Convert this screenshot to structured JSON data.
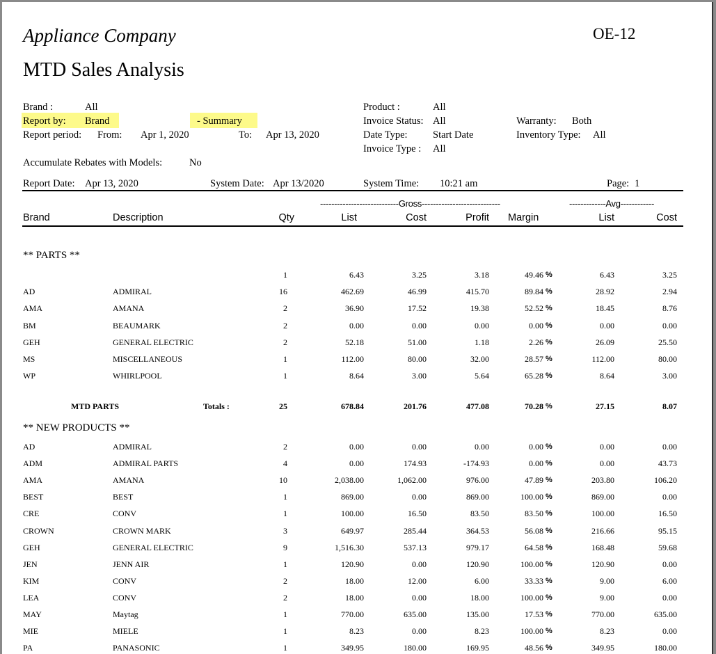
{
  "header": {
    "company": "Appliance Company",
    "report_id": "OE-12",
    "title": "MTD Sales Analysis"
  },
  "params": {
    "brand_label": "Brand :",
    "brand_value": "All",
    "report_by_label": "Report by:",
    "report_by_value": "Brand",
    "summary": "- Summary",
    "period_label": "Report period:",
    "from_label": "From:",
    "from_value": "Apr 1, 2020",
    "to_label": "To:",
    "to_value": "Apr 13, 2020",
    "product_label": "Product :",
    "product_value": "All",
    "invoice_status_label": "Invoice Status:",
    "invoice_status_value": "All",
    "date_type_label": "Date Type:",
    "date_type_value": "Start Date",
    "invoice_type_label": "Invoice Type :",
    "invoice_type_value": "All",
    "warranty_label": "Warranty:",
    "warranty_value": "Both",
    "inventory_type_label": "Inventory Type:",
    "inventory_type_value": "All",
    "accum_label": "Accumulate Rebates with Models:",
    "accum_value": "No",
    "report_date_label": "Report Date:",
    "report_date_value": "Apr 13, 2020",
    "system_date_label": "System Date:",
    "system_date_value": "Apr 13/2020",
    "system_time_label": "System Time:",
    "system_time_value": "10:21 am",
    "page_label": "Page:",
    "page_value": "1"
  },
  "columns": {
    "gross_group": "----------------------------Gross----------------------------",
    "avg_group": "-------------Avg------------",
    "brand": "Brand",
    "description": "Description",
    "qty": "Qty",
    "list": "List",
    "cost": "Cost",
    "profit": "Profit",
    "margin": "Margin",
    "avg_list": "List",
    "avg_cost": "Cost"
  },
  "sections": [
    {
      "title": "** PARTS **",
      "rows": [
        {
          "brand": "",
          "desc": "",
          "qty": "1",
          "list": "6.43",
          "cost": "3.25",
          "profit": "3.18",
          "margin": "49.46",
          "avg_list": "6.43",
          "avg_cost": "3.25"
        },
        {
          "brand": "AD",
          "desc": "ADMIRAL",
          "qty": "16",
          "list": "462.69",
          "cost": "46.99",
          "profit": "415.70",
          "margin": "89.84",
          "avg_list": "28.92",
          "avg_cost": "2.94"
        },
        {
          "brand": "AMA",
          "desc": "AMANA",
          "qty": "2",
          "list": "36.90",
          "cost": "17.52",
          "profit": "19.38",
          "margin": "52.52",
          "avg_list": "18.45",
          "avg_cost": "8.76"
        },
        {
          "brand": "BM",
          "desc": "BEAUMARK",
          "qty": "2",
          "list": "0.00",
          "cost": "0.00",
          "profit": "0.00",
          "margin": "0.00",
          "avg_list": "0.00",
          "avg_cost": "0.00"
        },
        {
          "brand": "GEH",
          "desc": "GENERAL ELECTRIC",
          "qty": "2",
          "list": "52.18",
          "cost": "51.00",
          "profit": "1.18",
          "margin": "2.26",
          "avg_list": "26.09",
          "avg_cost": "25.50"
        },
        {
          "brand": "MS",
          "desc": "MISCELLANEOUS",
          "qty": "1",
          "list": "112.00",
          "cost": "80.00",
          "profit": "32.00",
          "margin": "28.57",
          "avg_list": "112.00",
          "avg_cost": "80.00"
        },
        {
          "brand": "WP",
          "desc": "WHIRLPOOL",
          "qty": "1",
          "list": "8.64",
          "cost": "3.00",
          "profit": "5.64",
          "margin": "65.28",
          "avg_list": "8.64",
          "avg_cost": "3.00"
        }
      ],
      "total": {
        "label": "MTD  PARTS",
        "totals_label": "Totals :",
        "qty": "25",
        "list": "678.84",
        "cost": "201.76",
        "profit": "477.08",
        "margin": "70.28",
        "avg_list": "27.15",
        "avg_cost": "8.07"
      }
    },
    {
      "title": "** NEW PRODUCTS **",
      "rows": [
        {
          "brand": "AD",
          "desc": "ADMIRAL",
          "qty": "2",
          "list": "0.00",
          "cost": "0.00",
          "profit": "0.00",
          "margin": "0.00",
          "avg_list": "0.00",
          "avg_cost": "0.00"
        },
        {
          "brand": "ADM",
          "desc": "ADMIRAL PARTS",
          "qty": "4",
          "list": "0.00",
          "cost": "174.93",
          "profit": "-174.93",
          "margin": "0.00",
          "avg_list": "0.00",
          "avg_cost": "43.73"
        },
        {
          "brand": "AMA",
          "desc": "AMANA",
          "qty": "10",
          "list": "2,038.00",
          "cost": "1,062.00",
          "profit": "976.00",
          "margin": "47.89",
          "avg_list": "203.80",
          "avg_cost": "106.20"
        },
        {
          "brand": "BEST",
          "desc": "BEST",
          "qty": "1",
          "list": "869.00",
          "cost": "0.00",
          "profit": "869.00",
          "margin": "100.00",
          "avg_list": "869.00",
          "avg_cost": "0.00"
        },
        {
          "brand": "CRE",
          "desc": "CONV",
          "qty": "1",
          "list": "100.00",
          "cost": "16.50",
          "profit": "83.50",
          "margin": "83.50",
          "avg_list": "100.00",
          "avg_cost": "16.50"
        },
        {
          "brand": "CROWN",
          "desc": "CROWN MARK",
          "qty": "3",
          "list": "649.97",
          "cost": "285.44",
          "profit": "364.53",
          "margin": "56.08",
          "avg_list": "216.66",
          "avg_cost": "95.15"
        },
        {
          "brand": "GEH",
          "desc": "GENERAL ELECTRIC",
          "qty": "9",
          "list": "1,516.30",
          "cost": "537.13",
          "profit": "979.17",
          "margin": "64.58",
          "avg_list": "168.48",
          "avg_cost": "59.68"
        },
        {
          "brand": "JEN",
          "desc": "JENN AIR",
          "qty": "1",
          "list": "120.90",
          "cost": "0.00",
          "profit": "120.90",
          "margin": "100.00",
          "avg_list": "120.90",
          "avg_cost": "0.00"
        },
        {
          "brand": "KIM",
          "desc": "CONV",
          "qty": "2",
          "list": "18.00",
          "cost": "12.00",
          "profit": "6.00",
          "margin": "33.33",
          "avg_list": "9.00",
          "avg_cost": "6.00"
        },
        {
          "brand": "LEA",
          "desc": "CONV",
          "qty": "2",
          "list": "18.00",
          "cost": "0.00",
          "profit": "18.00",
          "margin": "100.00",
          "avg_list": "9.00",
          "avg_cost": "0.00"
        },
        {
          "brand": "MAY",
          "desc": "Maytag",
          "qty": "1",
          "list": "770.00",
          "cost": "635.00",
          "profit": "135.00",
          "margin": "17.53",
          "avg_list": "770.00",
          "avg_cost": "635.00"
        },
        {
          "brand": "MIE",
          "desc": "MIELE",
          "qty": "1",
          "list": "8.23",
          "cost": "0.00",
          "profit": "8.23",
          "margin": "100.00",
          "avg_list": "8.23",
          "avg_cost": "0.00"
        },
        {
          "brand": "PA",
          "desc": "PANASONIC",
          "qty": "1",
          "list": "349.95",
          "cost": "180.00",
          "profit": "169.95",
          "margin": "48.56",
          "avg_list": "349.95",
          "avg_cost": "180.00"
        }
      ]
    }
  ],
  "percent_sign": "%"
}
